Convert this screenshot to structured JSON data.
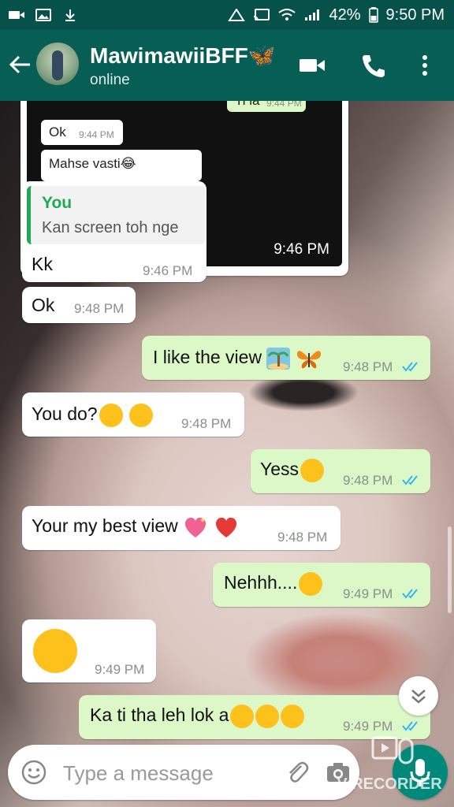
{
  "status_bar": {
    "battery": "42%",
    "time": "9:50 PM",
    "icons_left": [
      "video-recorder-icon",
      "gallery-icon",
      "download-icon"
    ],
    "icons_right": [
      "nfc-icon",
      "cast-icon",
      "wifi-icon",
      "signal-icon",
      "battery-icon"
    ]
  },
  "header": {
    "contact_name": "MawimawiiBFF🦋",
    "status": "online",
    "icons": [
      "back-arrow-icon",
      "video-call-icon",
      "phone-call-icon",
      "more-options-icon"
    ]
  },
  "shared_image": {
    "time": "9:46 PM",
    "mini_messages": [
      {
        "text": "Ti la",
        "time": "9:44 PM",
        "side": "out"
      },
      {
        "text": "Ok",
        "time": "9:44 PM",
        "side": "in"
      },
      {
        "text": "Mahse vasti😂",
        "side": "in"
      }
    ]
  },
  "reply_message": {
    "quote_author": "You",
    "quote_text": "Kan screen toh nge",
    "text": "Kk",
    "time": "9:46 PM"
  },
  "messages": [
    {
      "id": "m1",
      "side": "in",
      "text": "Ok",
      "time": "9:48 PM"
    },
    {
      "id": "m2",
      "side": "out",
      "text": "I like the view",
      "emojis": [
        "island-emoji",
        "butterfly-emoji"
      ],
      "time": "9:48 PM",
      "status": "read"
    },
    {
      "id": "m3",
      "side": "in",
      "text": "You do?",
      "emojis": [
        "hugging-face-emoji",
        "thinking-face-emoji"
      ],
      "time": "9:48 PM"
    },
    {
      "id": "m4",
      "side": "out",
      "text": "Yess",
      "emojis": [
        "grinning-face-emoji"
      ],
      "time": "9:48 PM",
      "status": "read"
    },
    {
      "id": "m5",
      "side": "in",
      "text": "Your my best view",
      "emojis": [
        "sparkling-heart-emoji",
        "red-heart-emoji"
      ],
      "time": "9:48 PM"
    },
    {
      "id": "m6",
      "side": "out",
      "text": "Nehhh....",
      "emojis": [
        "confounded-face-emoji"
      ],
      "time": "9:49 PM",
      "status": "read"
    },
    {
      "id": "m7",
      "side": "in",
      "text": "",
      "emojis": [
        "tired-face-emoji"
      ],
      "time": "9:49 PM"
    },
    {
      "id": "m8",
      "side": "out",
      "text": "Ka ti tha leh lok a",
      "emojis": [
        "tears-of-joy-emoji",
        "tears-of-joy-emoji",
        "tears-of-joy-emoji"
      ],
      "time": "9:49 PM",
      "status": "read"
    }
  ],
  "composer": {
    "placeholder": "Type a message",
    "icons": [
      "emoji-icon",
      "attach-icon",
      "camera-icon",
      "mic-icon"
    ]
  },
  "watermark": "V RECORDER",
  "colors": {
    "header": "#075e54",
    "statusbar": "#06524a",
    "outgoing_bubble": "#dcf8c6",
    "incoming_bubble": "#ffffff",
    "read_ticks": "#34b7f1",
    "accent": "#00897b"
  }
}
